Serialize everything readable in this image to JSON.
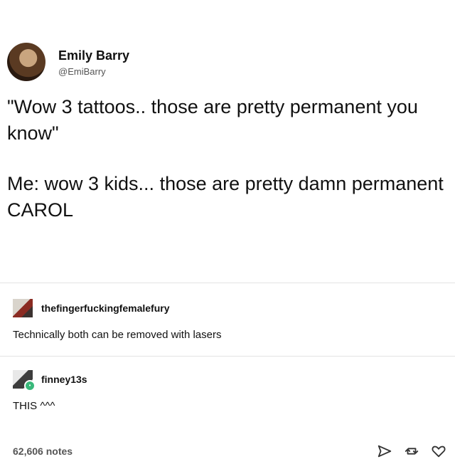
{
  "tweet": {
    "display_name": "Emily Barry",
    "handle": "@EmiBarry",
    "text_1": "\"Wow 3 tattoos.. those are pretty permanent you know\"",
    "text_2": "Me: wow 3 kids... those are pretty damn permanent CAROL"
  },
  "reblogs": [
    {
      "username": "thefingerfuckingfemalefury",
      "body": "Technically both can be removed with lasers"
    },
    {
      "username": "finney13s",
      "body": "THIS ^^^"
    }
  ],
  "footer": {
    "notes": "62,606 notes",
    "icons": [
      "share-icon",
      "reblog-icon",
      "heart-icon"
    ]
  }
}
